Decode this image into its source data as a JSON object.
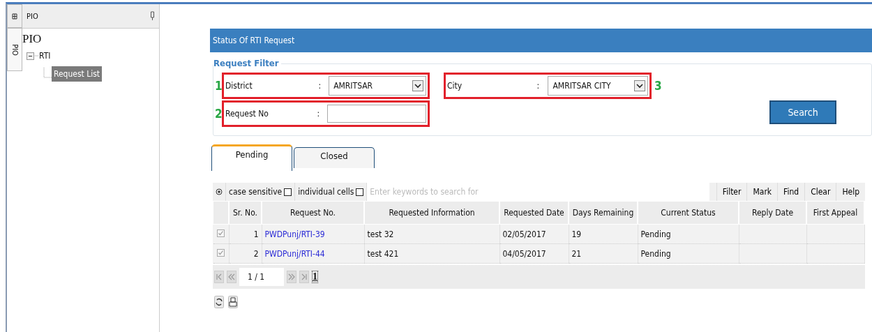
{
  "side_panel": {
    "vertical_tabs": [
      {
        "kind": "icon",
        "selected": false
      },
      {
        "kind": "text",
        "label": "PIO",
        "selected": true
      }
    ],
    "title": "PIO",
    "tree": [
      {
        "label": "PIO",
        "kind": "root",
        "selected": false,
        "children": [
          {
            "label": "RTI",
            "kind": "folder",
            "expanded": true,
            "selected": false,
            "children": [
              {
                "label": "Request List",
                "kind": "leaf",
                "selected": true
              }
            ]
          }
        ]
      }
    ]
  },
  "page": {
    "title": "Status Of RTI Request",
    "filter": {
      "legend": "Request Filter",
      "fields": [
        {
          "kind": "select",
          "label": "District",
          "colon": ":",
          "value": "AMRITSAR",
          "marker": "1"
        },
        {
          "kind": "select",
          "label": "City",
          "colon": ":",
          "value": "AMRITSAR CITY",
          "marker": "3"
        },
        {
          "kind": "text",
          "label": "Request No",
          "colon": ":",
          "marker": "2"
        }
      ],
      "search_button": "Search"
    },
    "tabs": [
      {
        "label": "Pending",
        "selected": true
      },
      {
        "label": "Closed",
        "selected": false
      }
    ],
    "grid": {
      "toolbar": {
        "options": [
          {
            "label": "case sensitive",
            "checked": false
          },
          {
            "label": "individual cells",
            "checked": false
          }
        ],
        "search_placeholder": "Enter keywords to search for",
        "buttons": [
          "Filter",
          "Mark",
          "Find",
          "Clear",
          "Help"
        ]
      },
      "columns": [
        "Sr. No.",
        "Request No.",
        "Requested Information",
        "Requested Date",
        "Days Remaining",
        "Current Status",
        "Reply Date",
        "First Appeal"
      ],
      "rows": [
        {
          "checked": true,
          "cells": [
            "1",
            "PWDPunj/RTI-39",
            "test 32",
            "02/05/2017",
            "19",
            "Pending",
            "",
            ""
          ]
        },
        {
          "checked": true,
          "cells": [
            "2",
            "PWDPunj/RTI-44",
            "test 421",
            "04/05/2017",
            "21",
            "Pending",
            "",
            ""
          ]
        }
      ],
      "pager": {
        "page_info": "1 / 1",
        "pages": [
          {
            "label": "1",
            "selected": true
          }
        ]
      }
    }
  }
}
